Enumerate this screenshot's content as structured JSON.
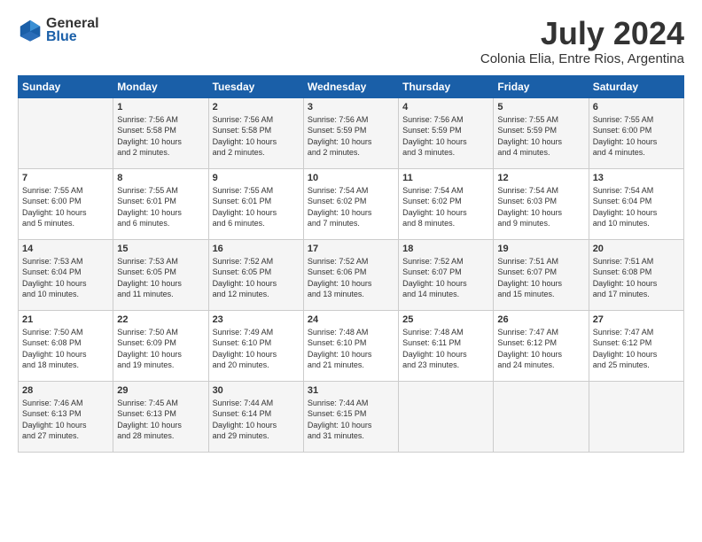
{
  "header": {
    "logo_line1": "General",
    "logo_line2": "Blue",
    "month": "July 2024",
    "location": "Colonia Elia, Entre Rios, Argentina"
  },
  "weekdays": [
    "Sunday",
    "Monday",
    "Tuesday",
    "Wednesday",
    "Thursday",
    "Friday",
    "Saturday"
  ],
  "weeks": [
    [
      {
        "day": "",
        "info": ""
      },
      {
        "day": "1",
        "info": "Sunrise: 7:56 AM\nSunset: 5:58 PM\nDaylight: 10 hours\nand 2 minutes."
      },
      {
        "day": "2",
        "info": "Sunrise: 7:56 AM\nSunset: 5:58 PM\nDaylight: 10 hours\nand 2 minutes."
      },
      {
        "day": "3",
        "info": "Sunrise: 7:56 AM\nSunset: 5:59 PM\nDaylight: 10 hours\nand 2 minutes."
      },
      {
        "day": "4",
        "info": "Sunrise: 7:56 AM\nSunset: 5:59 PM\nDaylight: 10 hours\nand 3 minutes."
      },
      {
        "day": "5",
        "info": "Sunrise: 7:55 AM\nSunset: 5:59 PM\nDaylight: 10 hours\nand 4 minutes."
      },
      {
        "day": "6",
        "info": "Sunrise: 7:55 AM\nSunset: 6:00 PM\nDaylight: 10 hours\nand 4 minutes."
      }
    ],
    [
      {
        "day": "7",
        "info": "Sunrise: 7:55 AM\nSunset: 6:00 PM\nDaylight: 10 hours\nand 5 minutes."
      },
      {
        "day": "8",
        "info": "Sunrise: 7:55 AM\nSunset: 6:01 PM\nDaylight: 10 hours\nand 6 minutes."
      },
      {
        "day": "9",
        "info": "Sunrise: 7:55 AM\nSunset: 6:01 PM\nDaylight: 10 hours\nand 6 minutes."
      },
      {
        "day": "10",
        "info": "Sunrise: 7:54 AM\nSunset: 6:02 PM\nDaylight: 10 hours\nand 7 minutes."
      },
      {
        "day": "11",
        "info": "Sunrise: 7:54 AM\nSunset: 6:02 PM\nDaylight: 10 hours\nand 8 minutes."
      },
      {
        "day": "12",
        "info": "Sunrise: 7:54 AM\nSunset: 6:03 PM\nDaylight: 10 hours\nand 9 minutes."
      },
      {
        "day": "13",
        "info": "Sunrise: 7:54 AM\nSunset: 6:04 PM\nDaylight: 10 hours\nand 10 minutes."
      }
    ],
    [
      {
        "day": "14",
        "info": "Sunrise: 7:53 AM\nSunset: 6:04 PM\nDaylight: 10 hours\nand 10 minutes."
      },
      {
        "day": "15",
        "info": "Sunrise: 7:53 AM\nSunset: 6:05 PM\nDaylight: 10 hours\nand 11 minutes."
      },
      {
        "day": "16",
        "info": "Sunrise: 7:52 AM\nSunset: 6:05 PM\nDaylight: 10 hours\nand 12 minutes."
      },
      {
        "day": "17",
        "info": "Sunrise: 7:52 AM\nSunset: 6:06 PM\nDaylight: 10 hours\nand 13 minutes."
      },
      {
        "day": "18",
        "info": "Sunrise: 7:52 AM\nSunset: 6:07 PM\nDaylight: 10 hours\nand 14 minutes."
      },
      {
        "day": "19",
        "info": "Sunrise: 7:51 AM\nSunset: 6:07 PM\nDaylight: 10 hours\nand 15 minutes."
      },
      {
        "day": "20",
        "info": "Sunrise: 7:51 AM\nSunset: 6:08 PM\nDaylight: 10 hours\nand 17 minutes."
      }
    ],
    [
      {
        "day": "21",
        "info": "Sunrise: 7:50 AM\nSunset: 6:08 PM\nDaylight: 10 hours\nand 18 minutes."
      },
      {
        "day": "22",
        "info": "Sunrise: 7:50 AM\nSunset: 6:09 PM\nDaylight: 10 hours\nand 19 minutes."
      },
      {
        "day": "23",
        "info": "Sunrise: 7:49 AM\nSunset: 6:10 PM\nDaylight: 10 hours\nand 20 minutes."
      },
      {
        "day": "24",
        "info": "Sunrise: 7:48 AM\nSunset: 6:10 PM\nDaylight: 10 hours\nand 21 minutes."
      },
      {
        "day": "25",
        "info": "Sunrise: 7:48 AM\nSunset: 6:11 PM\nDaylight: 10 hours\nand 23 minutes."
      },
      {
        "day": "26",
        "info": "Sunrise: 7:47 AM\nSunset: 6:12 PM\nDaylight: 10 hours\nand 24 minutes."
      },
      {
        "day": "27",
        "info": "Sunrise: 7:47 AM\nSunset: 6:12 PM\nDaylight: 10 hours\nand 25 minutes."
      }
    ],
    [
      {
        "day": "28",
        "info": "Sunrise: 7:46 AM\nSunset: 6:13 PM\nDaylight: 10 hours\nand 27 minutes."
      },
      {
        "day": "29",
        "info": "Sunrise: 7:45 AM\nSunset: 6:13 PM\nDaylight: 10 hours\nand 28 minutes."
      },
      {
        "day": "30",
        "info": "Sunrise: 7:44 AM\nSunset: 6:14 PM\nDaylight: 10 hours\nand 29 minutes."
      },
      {
        "day": "31",
        "info": "Sunrise: 7:44 AM\nSunset: 6:15 PM\nDaylight: 10 hours\nand 31 minutes."
      },
      {
        "day": "",
        "info": ""
      },
      {
        "day": "",
        "info": ""
      },
      {
        "day": "",
        "info": ""
      }
    ]
  ]
}
